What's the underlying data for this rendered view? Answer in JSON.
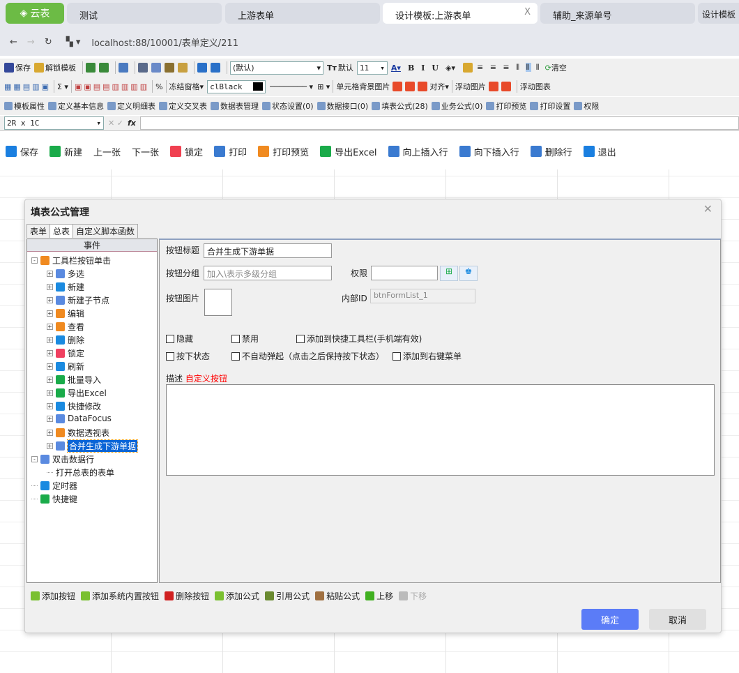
{
  "browser": {
    "logo": "云表",
    "tabs": [
      {
        "label": "测试"
      },
      {
        "label": "上游表单"
      },
      {
        "label": "设计模板:上游表单",
        "active": true,
        "close": "X"
      },
      {
        "label": "辅助_来源单号"
      },
      {
        "label": "设计模板"
      }
    ],
    "url": "localhost:88/10001/表单定义/211"
  },
  "toolbar1": [
    {
      "icon": "save-icon",
      "label": "保存",
      "color": "#34489a"
    },
    {
      "icon": "unlock-icon",
      "label": "解锁模板",
      "color": "#d8a830"
    },
    {
      "icon": "import-icon",
      "label": "",
      "color": "#3a8a3a"
    },
    {
      "icon": "export-icon",
      "label": "",
      "color": "#3a8a3a"
    },
    {
      "icon": "exit-icon",
      "label": "",
      "color": "#4a7ac0"
    },
    {
      "icon": "cut-icon",
      "label": "",
      "color": "#5a6a8a"
    },
    {
      "icon": "copy-icon",
      "label": "",
      "color": "#6a8ac8"
    },
    {
      "icon": "paste-icon",
      "label": "",
      "color": "#8a7030"
    },
    {
      "icon": "format-brush-icon",
      "label": "",
      "color": "#c8a040"
    },
    {
      "icon": "undo-icon",
      "label": "",
      "color": "#2a70c8"
    },
    {
      "icon": "redo-icon",
      "label": "",
      "color": "#2a70c8"
    }
  ],
  "font": {
    "name": "(默认)",
    "default_label": "默认",
    "size": "11"
  },
  "toolbar1b": [
    {
      "icon": "bold-icon",
      "label": "B"
    },
    {
      "icon": "italic-icon",
      "label": "I"
    },
    {
      "icon": "underline-icon",
      "label": "U"
    }
  ],
  "clear_label": "清空",
  "toolbar2": {
    "freeze": "冻结窗格",
    "color": "clBlack",
    "bg_image": "单元格背景图片",
    "align": "对齐",
    "float_image": "浮动图片",
    "float_chart": "浮动图表"
  },
  "toolbar3": [
    {
      "icon": "template-props-icon",
      "label": "模板属性"
    },
    {
      "icon": "basic-info-icon",
      "label": "定义基本信息"
    },
    {
      "icon": "detail-table-icon",
      "label": "定义明细表"
    },
    {
      "icon": "cross-table-icon",
      "label": "定义交叉表"
    },
    {
      "icon": "datatable-icon",
      "label": "数据表管理"
    },
    {
      "icon": "status-icon",
      "label": "状态设置(0)"
    },
    {
      "icon": "data-interface-icon",
      "label": "数据接口(0)"
    },
    {
      "icon": "flag-icon",
      "label": "填表公式(28)"
    },
    {
      "icon": "flag-icon",
      "label": "业务公式(0)"
    },
    {
      "icon": "print-preview-icon",
      "label": "打印预览"
    },
    {
      "icon": "print-settings-icon",
      "label": "打印设置"
    },
    {
      "icon": "permission-icon",
      "label": "权限"
    }
  ],
  "formula": {
    "cell_ref": "2R x 1C",
    "fx": "fx"
  },
  "actions": [
    {
      "icon": "save-icon",
      "label": "保存",
      "color": "#1a7fe0"
    },
    {
      "icon": "new-icon",
      "label": "新建",
      "color": "#1aab4a"
    },
    {
      "icon": "",
      "label": "上一张",
      "color": ""
    },
    {
      "icon": "",
      "label": "下一张",
      "color": ""
    },
    {
      "icon": "lock-icon",
      "label": "锁定",
      "color": "#f04050"
    },
    {
      "icon": "print-icon",
      "label": "打印",
      "color": "#3a7ad0"
    },
    {
      "icon": "print-preview-icon",
      "label": "打印预览",
      "color": "#f08a20"
    },
    {
      "icon": "excel-icon",
      "label": "导出Excel",
      "color": "#1aab4a"
    },
    {
      "icon": "insert-up-icon",
      "label": "向上插入行",
      "color": "#3a7ad0"
    },
    {
      "icon": "insert-down-icon",
      "label": "向下插入行",
      "color": "#3a7ad0"
    },
    {
      "icon": "delete-row-icon",
      "label": "删除行",
      "color": "#3a7ad0"
    },
    {
      "icon": "power-icon",
      "label": "退出",
      "color": "#1a7fe0"
    }
  ],
  "dialog": {
    "title": "填表公式管理",
    "tabs": [
      "表单",
      "总表",
      "自定义脚本函数"
    ],
    "tree_header": "事件",
    "tree": [
      {
        "label": "工具栏按钮单击",
        "level": 0,
        "icon": "tools-icon",
        "color": "#f08a20",
        "pm": "-"
      },
      {
        "label": "多选",
        "level": 1,
        "icon": "button-icon",
        "color": "#5a8ae0",
        "pm": "+"
      },
      {
        "label": "新建",
        "level": 1,
        "icon": "plus-icon",
        "color": "#1a8ae0",
        "pm": "+"
      },
      {
        "label": "新建子节点",
        "level": 1,
        "icon": "button-icon",
        "color": "#5a8ae0",
        "pm": "+"
      },
      {
        "label": "编辑",
        "level": 1,
        "icon": "folder-open-icon",
        "color": "#f08a20",
        "pm": "+"
      },
      {
        "label": "查看",
        "level": 1,
        "icon": "folder-open-icon",
        "color": "#f08a20",
        "pm": "+"
      },
      {
        "label": "删除",
        "level": 1,
        "icon": "delete-list-icon",
        "color": "#1a8ae0",
        "pm": "+"
      },
      {
        "label": "锁定",
        "level": 1,
        "icon": "lock-icon",
        "color": "#f04060",
        "pm": "+"
      },
      {
        "label": "刷新",
        "level": 1,
        "icon": "refresh-icon",
        "color": "#1a8ae0",
        "pm": "+"
      },
      {
        "label": "批量导入",
        "level": 1,
        "icon": "excel-import-icon",
        "color": "#1aab4a",
        "pm": "+"
      },
      {
        "label": "导出Excel",
        "level": 1,
        "icon": "excel-icon",
        "color": "#1aab4a",
        "pm": "+"
      },
      {
        "label": "快捷修改",
        "level": 1,
        "icon": "pencil-icon",
        "color": "#1a8ae0",
        "pm": "+"
      },
      {
        "label": "DataFocus",
        "level": 1,
        "icon": "bar-chart-icon",
        "color": "#5a8ae0",
        "pm": "+"
      },
      {
        "label": "数据透视表",
        "level": 1,
        "icon": "pivot-icon",
        "color": "#f08a20",
        "pm": "+"
      },
      {
        "label": "合并生成下游单据",
        "level": 1,
        "icon": "button-icon",
        "color": "#5a8ae0",
        "pm": "+",
        "selected": true
      },
      {
        "label": "双击数据行",
        "level": 0,
        "icon": "double-click-icon",
        "color": "#5a8ae0",
        "pm": "-"
      },
      {
        "label": "打开总表的表单",
        "level": 1,
        "icon": "",
        "color": "",
        "pm": ""
      },
      {
        "label": "定时器",
        "level": 0,
        "icon": "timer-icon",
        "color": "#1a8ae0",
        "pm": ""
      },
      {
        "label": "快捷键",
        "level": 0,
        "icon": "share-icon",
        "color": "#1aab4a",
        "pm": ""
      }
    ],
    "form": {
      "title_label": "按钮标题",
      "title_value": "合并生成下游单据",
      "group_label": "按钮分组",
      "group_placeholder": "加入\\表示多级分组",
      "permission_label": "权限",
      "permission_value": "",
      "image_label": "按钮图片",
      "internal_id_label": "内部ID",
      "internal_id_value": "btnFormList_1",
      "checkboxes": [
        {
          "label": "隐藏",
          "checked": false
        },
        {
          "label": "禁用",
          "checked": false
        },
        {
          "label": "添加到快捷工具栏(手机端有效)",
          "checked": false
        },
        {
          "label": "按下状态",
          "checked": false
        },
        {
          "label": "不自动弹起（点击之后保持按下状态）",
          "checked": false
        },
        {
          "label": "添加到右键菜单",
          "checked": false
        }
      ],
      "desc_label": "描述",
      "desc_value": "自定义按钮",
      "desc_color": "#ff0000"
    },
    "bottom": [
      {
        "icon": "add-icon",
        "label": "添加按钮",
        "color": "#7ac030"
      },
      {
        "icon": "add-icon",
        "label": "添加系统内置按钮",
        "color": "#7ac030"
      },
      {
        "icon": "delete-icon",
        "label": "删除按钮",
        "color": "#d02020"
      },
      {
        "icon": "add-icon",
        "label": "添加公式",
        "color": "#7ac030"
      },
      {
        "icon": "plug-icon",
        "label": "引用公式",
        "color": "#6a8a30"
      },
      {
        "icon": "clipboard-icon",
        "label": "粘贴公式",
        "color": "#a07040"
      },
      {
        "icon": "arrow-up-icon",
        "label": "上移",
        "color": "#40b020"
      },
      {
        "icon": "arrow-down-icon",
        "label": "下移",
        "color": "#bbbbbb",
        "disabled": true
      }
    ],
    "ok": "确定",
    "cancel": "取消",
    "ok_color": "#5b7cf7"
  }
}
